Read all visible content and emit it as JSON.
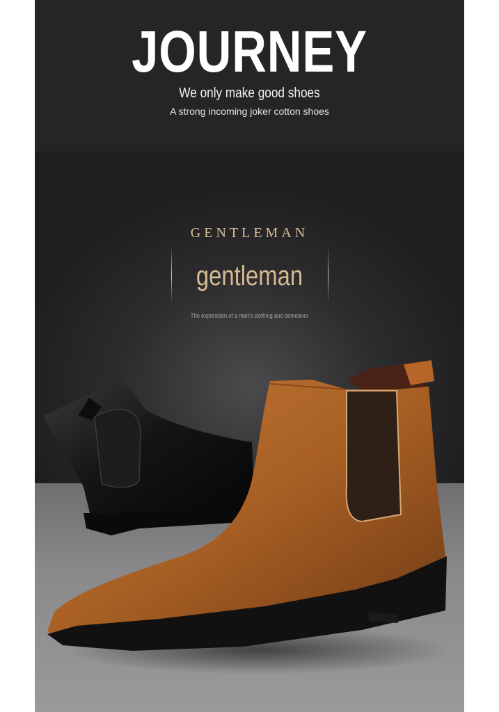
{
  "header": {
    "brand": "JOURNEY",
    "tagline": "We only make good shoes",
    "subtagline": "A strong incoming joker cotton shoes"
  },
  "feature": {
    "kicker": "GENTLEMAN",
    "headline": "gentleman",
    "caption": "The expression of a man's clothing and demeanor"
  },
  "products": [
    {
      "name": "black-chelsea-boot",
      "color": "#151515"
    },
    {
      "name": "brown-chelsea-boot",
      "color": "#b5682a"
    }
  ],
  "colors": {
    "background": "#1c1c1e",
    "accent_gold": "#d6ba92",
    "floor": "#8a8a8c"
  }
}
